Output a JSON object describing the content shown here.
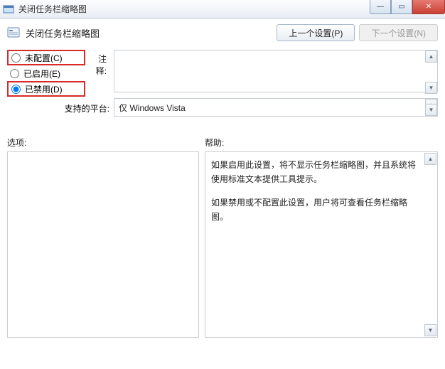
{
  "window": {
    "title": "关闭任务栏缩略图",
    "buttons": {
      "min": "—",
      "max": "▭",
      "close": "✕"
    }
  },
  "header": {
    "title": "关闭任务栏缩略图",
    "prev_btn": "上一个设置(P)",
    "next_btn": "下一个设置(N)"
  },
  "radios": {
    "not_configured": "未配置(C)",
    "enabled": "已启用(E)",
    "disabled": "已禁用(D)",
    "selected": "disabled"
  },
  "labels": {
    "comment": "注释:",
    "platform": "支持的平台:",
    "options": "选项:",
    "help": "帮助:"
  },
  "platform_text": "仅 Windows Vista",
  "comment_text": "",
  "help_text": {
    "p1": "如果启用此设置，将不显示任务栏缩略图，并且系统将使用标准文本提供工具提示。",
    "p2": "如果禁用或不配置此设置，用户将可查看任务栏缩略图。"
  }
}
